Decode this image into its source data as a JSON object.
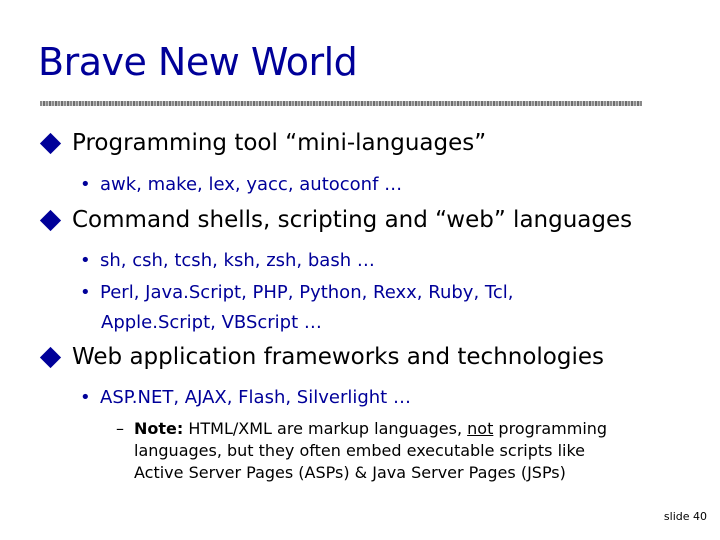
{
  "title": "Brave New World",
  "colors": {
    "title": "#000099",
    "sub_bullets": "#000099",
    "text": "#000000"
  },
  "icons": {
    "level1": "diamond-bullet-icon",
    "level2": "dot-bullet-icon",
    "level3": "dash-bullet-icon"
  },
  "bullets": [
    {
      "text": "Programming tool “mini-languages”",
      "sub": [
        "awk, make, lex, yacc, autoconf …"
      ]
    },
    {
      "text": "Command shells, scripting and “web” languages",
      "sub": [
        "sh, csh, tcsh, ksh, zsh, bash …",
        "Perl, Java.Script, PHP, Python, Rexx, Ruby, Tcl,",
        "Apple.Script, VBScript …"
      ]
    },
    {
      "text": "Web application frameworks and technologies",
      "sub": [
        "ASP.NET, AJAX, Flash, Silverlight …"
      ]
    }
  ],
  "note": {
    "dash": "–",
    "label": "Note:",
    "part1": " HTML/XML are markup languages, ",
    "underlined": "not",
    "part2": " programming",
    "line2": "languages, but they often embed executable scripts like",
    "line3": "Active Server Pages (ASPs) & Java Server Pages (JSPs)"
  },
  "footer": "slide 40"
}
